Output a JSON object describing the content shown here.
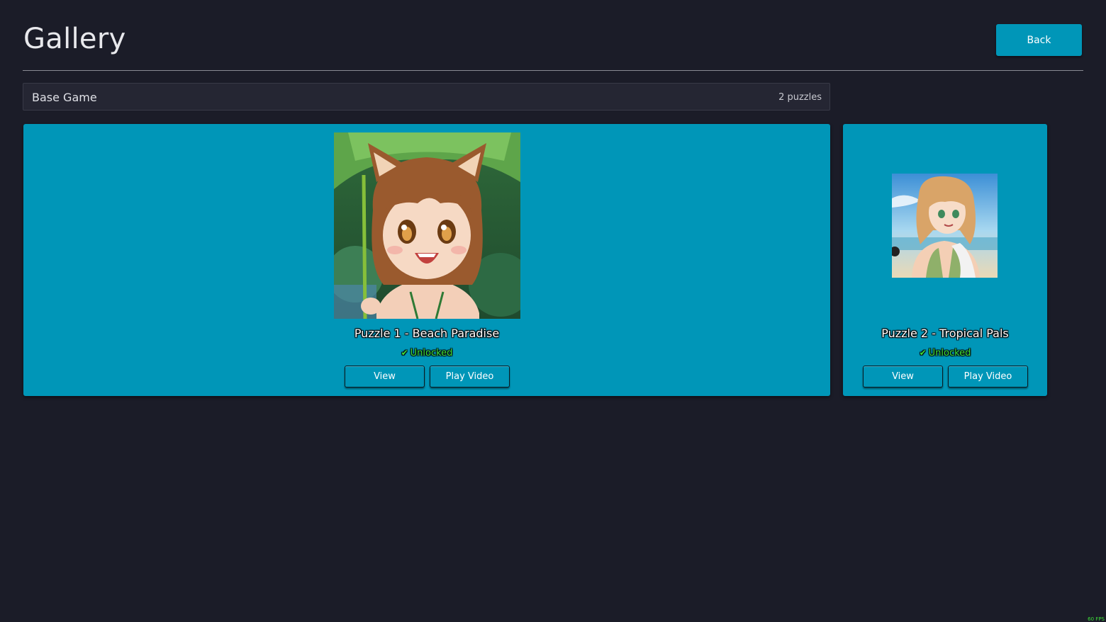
{
  "header": {
    "title": "Gallery",
    "back_label": "Back"
  },
  "section": {
    "title": "Base Game",
    "count": "2 puzzles"
  },
  "puzzles": [
    {
      "name": "Puzzle 1 - Beach Paradise",
      "status": "Unlocked",
      "view_label": "View",
      "video_label": "Play Video"
    },
    {
      "name": "Puzzle 2 - Tropical Pals",
      "status": "Unlocked",
      "view_label": "View",
      "video_label": "Play Video"
    }
  ],
  "overlay": {
    "fps": "60 FPS"
  },
  "colors": {
    "background": "#1b1c28",
    "accent": "#0096b8",
    "unlocked": "#3ee03a"
  }
}
